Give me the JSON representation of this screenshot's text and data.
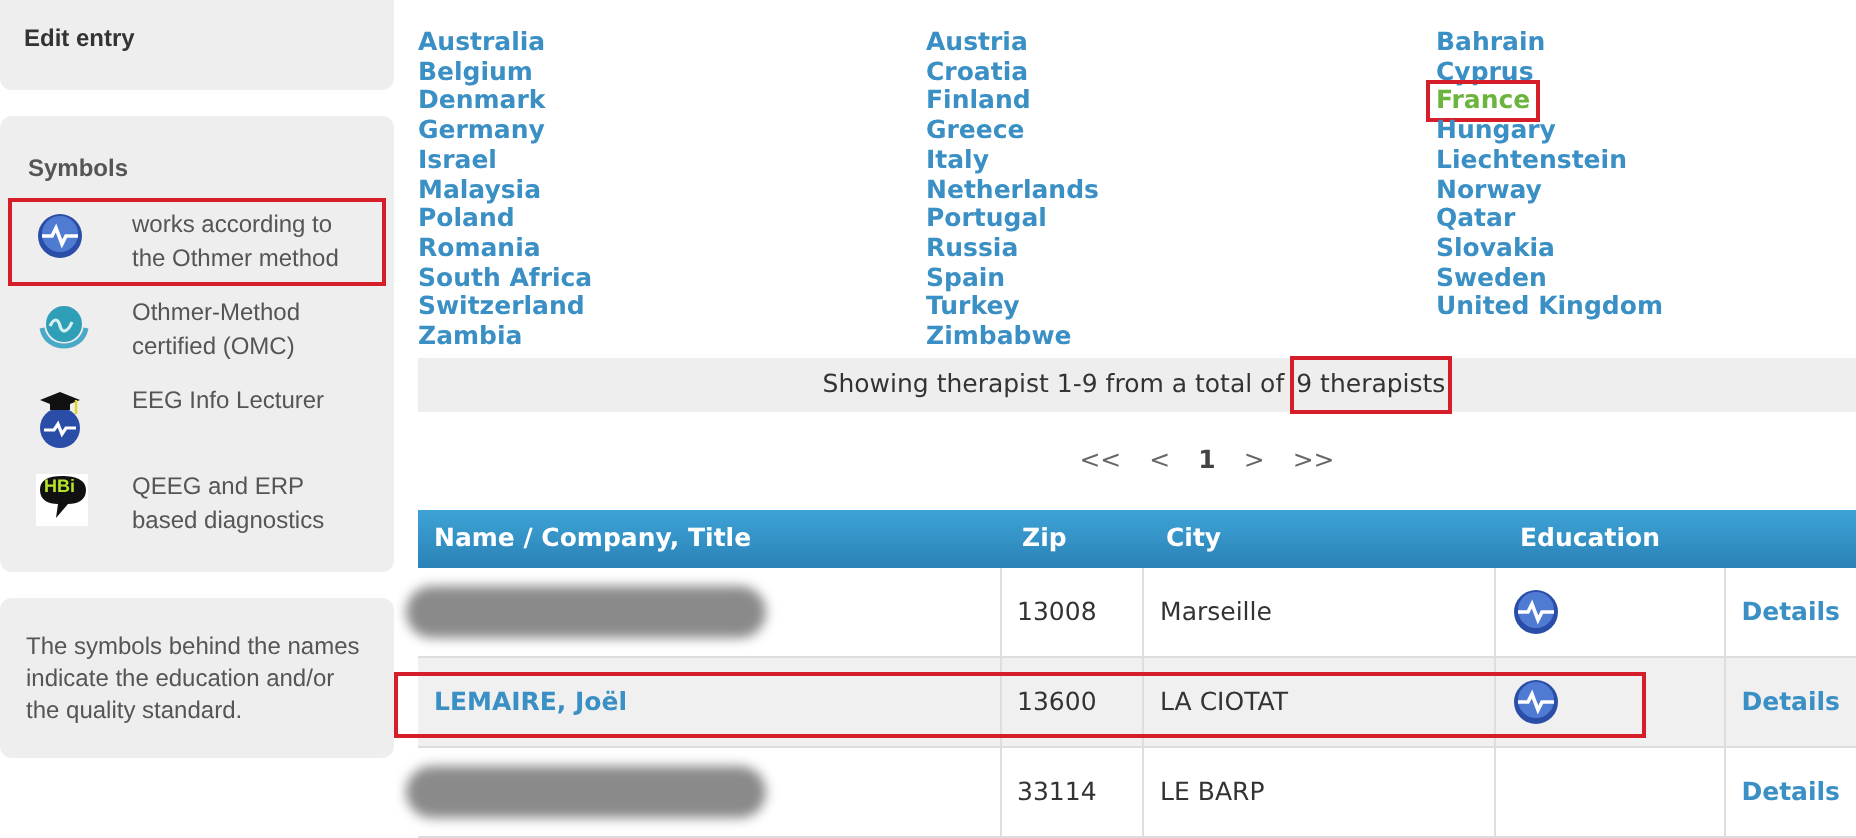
{
  "sidebar": {
    "edit_box": {
      "title": "Edit entry"
    },
    "symbols": {
      "title": "Symbols",
      "items": [
        {
          "kind": "othmer",
          "label": "works according to the Othmer method",
          "highlighted": true
        },
        {
          "kind": "omc",
          "label": "Othmer-Method certified (OMC)",
          "highlighted": false
        },
        {
          "kind": "lecturer",
          "label": "EEG Info Lecturer",
          "highlighted": false
        },
        {
          "kind": "qeeg",
          "badge_text": "HBi",
          "label": "QEEG and ERP based diagnostics",
          "highlighted": false
        }
      ]
    },
    "note": "The symbols behind the names indicate the education and/or the quality standard."
  },
  "countries": [
    [
      {
        "label": "Australia",
        "selected": false
      },
      {
        "label": "Belgium",
        "selected": false
      },
      {
        "label": "Denmark",
        "selected": false
      },
      {
        "label": "Germany",
        "selected": false
      },
      {
        "label": "Israel",
        "selected": false
      },
      {
        "label": "Malaysia",
        "selected": false
      },
      {
        "label": "Poland",
        "selected": false
      },
      {
        "label": "Romania",
        "selected": false
      },
      {
        "label": "South Africa",
        "selected": false
      },
      {
        "label": "Switzerland",
        "selected": false
      },
      {
        "label": "Zambia",
        "selected": false
      }
    ],
    [
      {
        "label": "Austria",
        "selected": false
      },
      {
        "label": "Croatia",
        "selected": false
      },
      {
        "label": "Finland",
        "selected": false
      },
      {
        "label": "Greece",
        "selected": false
      },
      {
        "label": "Italy",
        "selected": false
      },
      {
        "label": "Netherlands",
        "selected": false
      },
      {
        "label": "Portugal",
        "selected": false
      },
      {
        "label": "Russia",
        "selected": false
      },
      {
        "label": "Spain",
        "selected": false
      },
      {
        "label": "Turkey",
        "selected": false
      },
      {
        "label": "Zimbabwe",
        "selected": false
      }
    ],
    [
      {
        "label": "Bahrain",
        "selected": false
      },
      {
        "label": "Cyprus",
        "selected": false
      },
      {
        "label": "France",
        "selected": true,
        "highlighted": true
      },
      {
        "label": "Hungary",
        "selected": false
      },
      {
        "label": "Liechtenstein",
        "selected": false
      },
      {
        "label": "Norway",
        "selected": false
      },
      {
        "label": "Qatar",
        "selected": false
      },
      {
        "label": "Slovakia",
        "selected": false
      },
      {
        "label": "Sweden",
        "selected": false
      },
      {
        "label": "United Kingdom",
        "selected": false
      }
    ]
  ],
  "summary": {
    "text": "Showing therapist 1-9 from a total of",
    "total": "9 therapists",
    "total_highlighted": true
  },
  "pagination": [
    {
      "label": "<<",
      "selected": false
    },
    {
      "label": "<",
      "selected": false
    },
    {
      "label": "1",
      "selected": true
    },
    {
      "label": ">",
      "selected": false
    },
    {
      "label": ">>",
      "selected": false
    }
  ],
  "table": {
    "columns": [
      "Name / Company, Title",
      "Zip",
      "City",
      "Education"
    ],
    "rows": [
      {
        "name_redacted": true,
        "zip": "13008",
        "city": "Marseille",
        "education": {
          "kind": "othmer"
        },
        "details": "Details",
        "highlighted": false
      },
      {
        "name": "LEMAIRE, Joël",
        "zip": "13600",
        "city": "LA CIOTAT",
        "education": {
          "kind": "othmer"
        },
        "details": "Details",
        "highlighted": true
      },
      {
        "name_redacted": true,
        "zip": "33114",
        "city": "LE BARP",
        "details": "Details",
        "highlighted": false
      }
    ]
  }
}
